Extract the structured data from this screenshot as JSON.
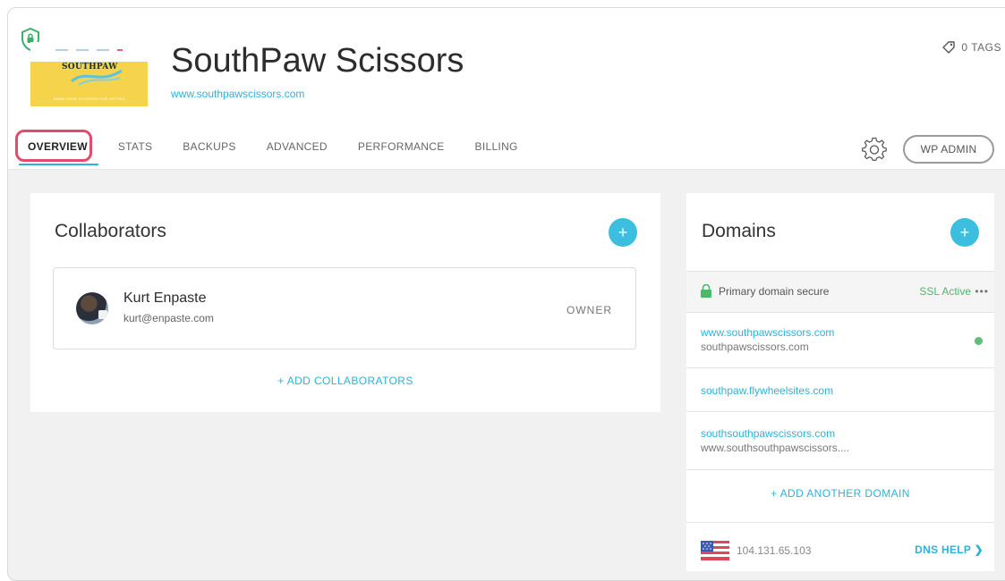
{
  "site": {
    "thumb_logo": "SOUTHPAW",
    "thumb_tagline": "DAMN GOOD SCISSORS FOR LEFTIES",
    "title": "SouthPaw Scissors",
    "url": "www.southpawscissors.com",
    "tags_label": "0 TAGS"
  },
  "tabs": [
    {
      "label": "OVERVIEW",
      "active": true
    },
    {
      "label": "STATS"
    },
    {
      "label": "BACKUPS"
    },
    {
      "label": "ADVANCED"
    },
    {
      "label": "PERFORMANCE"
    },
    {
      "label": "BILLING"
    }
  ],
  "wp_admin_label": "WP ADMIN",
  "collaborators": {
    "title": "Collaborators",
    "add_icon": "+",
    "items": [
      {
        "name": "Kurt Enpaste",
        "email": "kurt@enpaste.com",
        "role": "OWNER"
      }
    ],
    "add_label": "+ ADD COLLABORATORS"
  },
  "domains": {
    "title": "Domains",
    "add_icon": "+",
    "primary_text": "Primary domain secure",
    "ssl_text": "SSL Active",
    "more_icon": "•••",
    "items": [
      {
        "domain": "www.southpawscissors.com",
        "sub": "southpawscissors.com",
        "status": "active"
      },
      {
        "domain": "southpaw.flywheelsites.com",
        "sub": ""
      },
      {
        "domain": "southsouthpawscissors.com",
        "sub": "www.southsouthpawscissors...."
      }
    ],
    "add_label": "+ ADD ANOTHER DOMAIN",
    "ip_address": "104.131.65.103",
    "dns_help_label": "DNS HELP ❯"
  },
  "colors": {
    "accent": "#3cbede",
    "success": "#4bb86a",
    "highlight": "#e24b6b"
  },
  "icons": [
    "shield-lock-icon",
    "tag-icon",
    "gear-icon",
    "plus-icon",
    "lock-icon",
    "more-dots-icon",
    "status-dot-icon",
    "us-flag-icon",
    "chevron-right-icon"
  ]
}
